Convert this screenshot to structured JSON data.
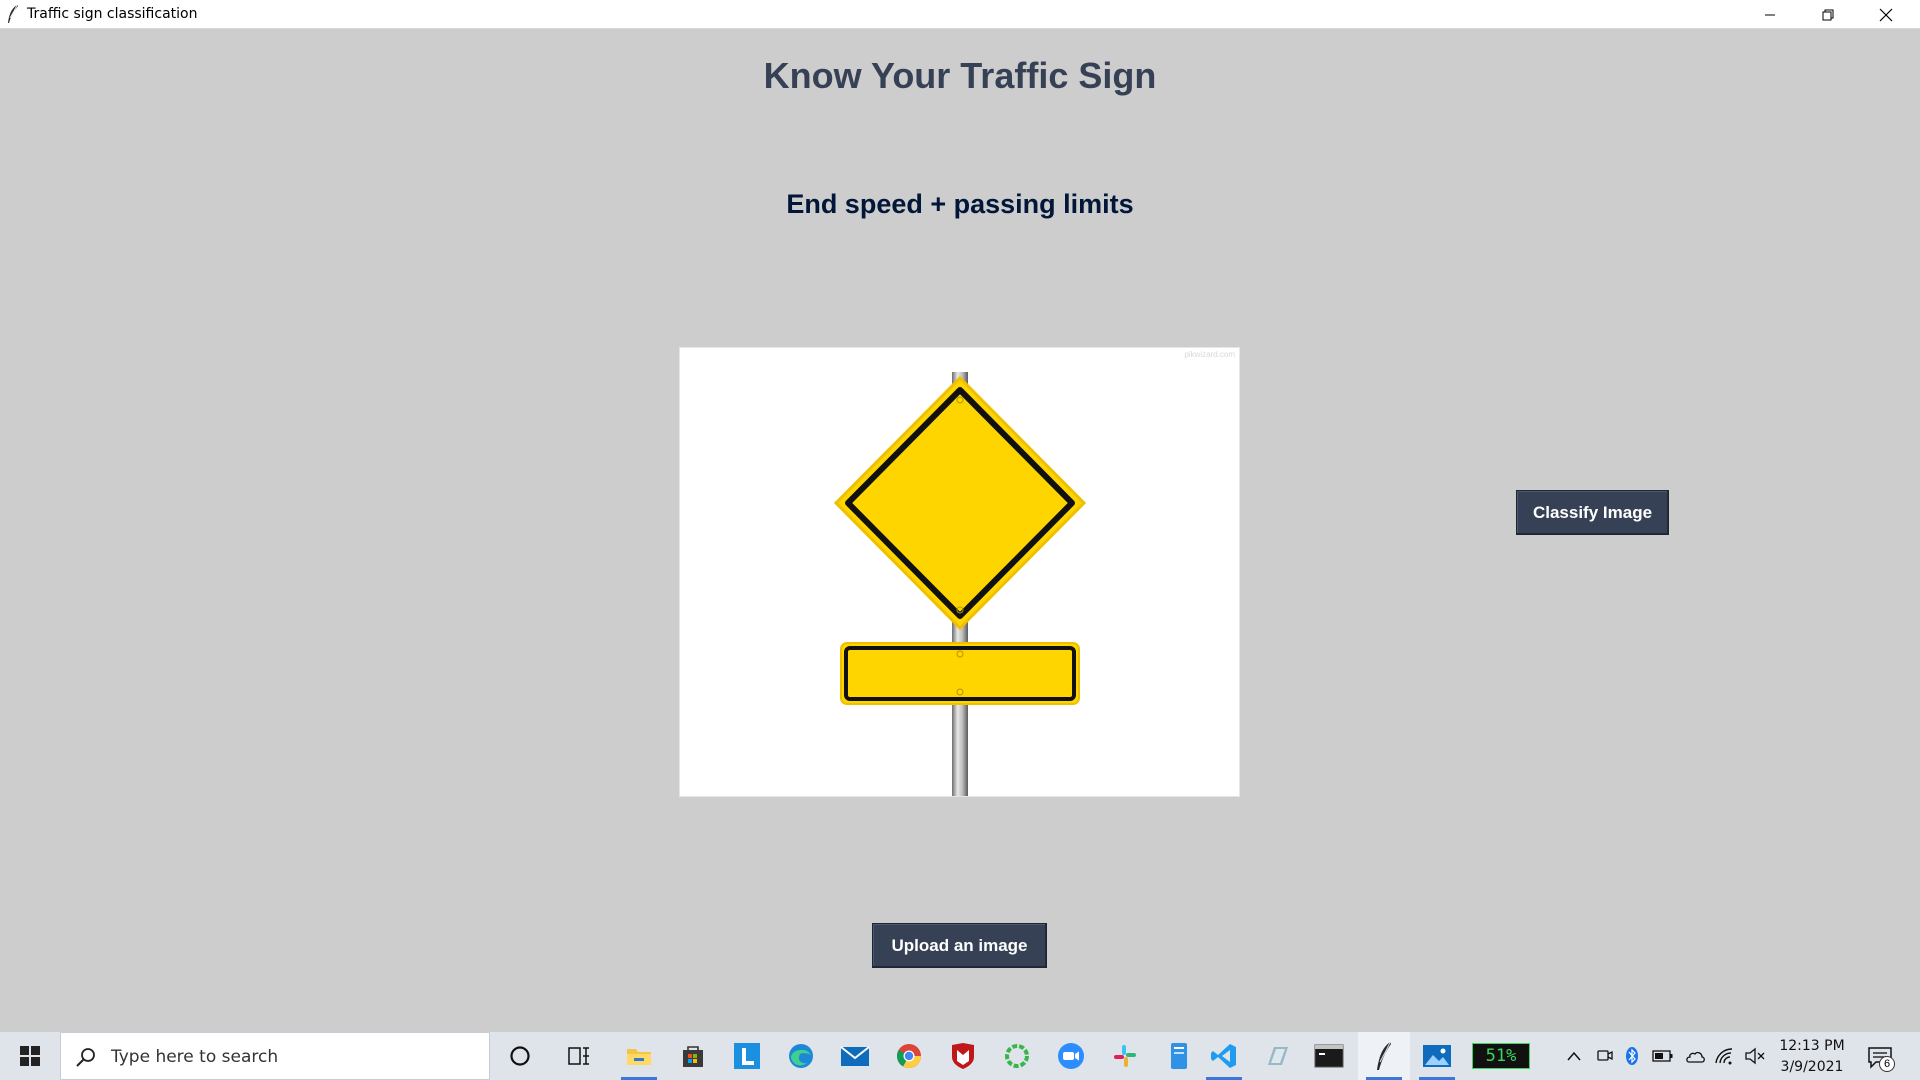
{
  "window": {
    "title": "Traffic sign classification"
  },
  "app": {
    "heading": "Know Your Traffic Sign",
    "result": "End speed + passing limits",
    "image_watermark": "pikwizard.com",
    "classify_button": "Classify Image",
    "upload_button": "Upload an image",
    "colors": {
      "background": "#cdcdcd",
      "heading": "#364156",
      "result": "#011638",
      "button_bg": "#364156",
      "button_text": "#ffffff",
      "sign_yellow": "#ffd500"
    }
  },
  "taskbar": {
    "search_placeholder": "Type here to search",
    "apps": [
      "cortana-icon",
      "task-view-icon",
      "file-explorer-icon",
      "store-icon",
      "l-app-icon",
      "edge-icon",
      "mail-icon",
      "chrome-icon",
      "mcafee-icon",
      "loading-ring-icon",
      "zoom-icon",
      "slack-icon",
      "notepad-icon",
      "vscode-icon",
      "pen-app-icon",
      "terminal-icon",
      "python-feather-icon",
      "photos-icon"
    ],
    "battery_percent": "51%",
    "clock_time": "12:13 PM",
    "clock_date": "3/9/2021",
    "notification_count": "6"
  }
}
